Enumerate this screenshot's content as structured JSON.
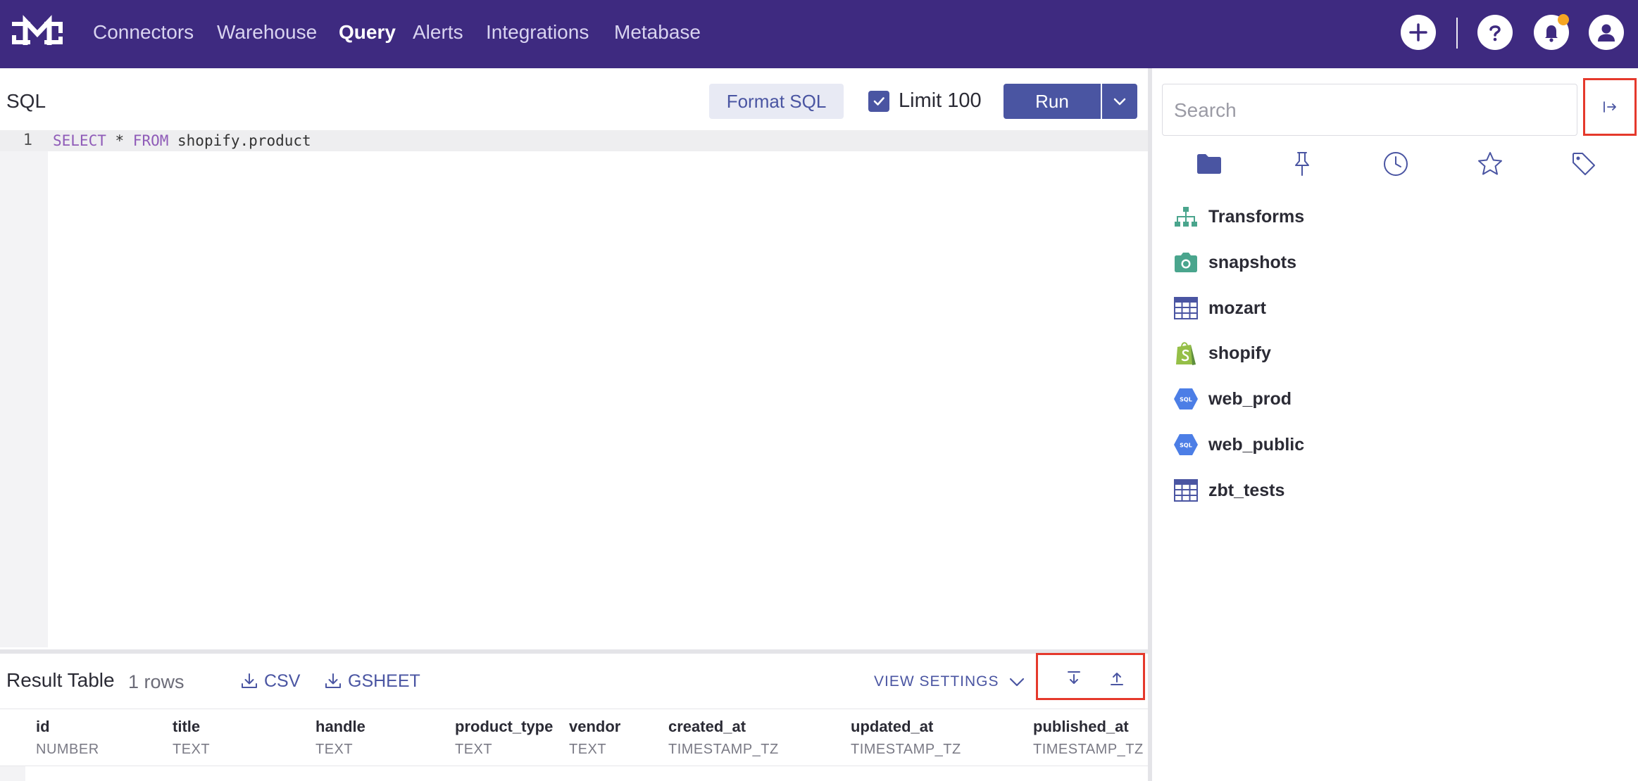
{
  "nav": {
    "items": [
      {
        "label": "Connectors"
      },
      {
        "label": "Warehouse"
      },
      {
        "label": "Query"
      },
      {
        "label": "Alerts"
      },
      {
        "label": "Integrations"
      },
      {
        "label": "Metabase"
      }
    ],
    "active": "Query",
    "logo_letter": "M"
  },
  "editor": {
    "title": "SQL",
    "format_label": "Format SQL",
    "limit_label": "Limit 100",
    "limit_checked": true,
    "run_label": "Run",
    "line_number": "1",
    "code": {
      "kw1": "SELECT",
      "mid": " * ",
      "kw2": "FROM",
      "rest": " shopify.product"
    }
  },
  "results": {
    "title": "Result Table",
    "count": "1 rows",
    "csv_label": "CSV",
    "gsheet_label": "GSHEET",
    "view_settings_label": "VIEW SETTINGS",
    "columns": [
      {
        "name": "id",
        "type": "NUMBER"
      },
      {
        "name": "title",
        "type": "TEXT"
      },
      {
        "name": "handle",
        "type": "TEXT"
      },
      {
        "name": "product_type",
        "type": "TEXT"
      },
      {
        "name": "vendor",
        "type": "TEXT"
      },
      {
        "name": "created_at",
        "type": "TIMESTAMP_TZ"
      },
      {
        "name": "updated_at",
        "type": "TIMESTAMP_TZ"
      },
      {
        "name": "published_at",
        "type": "TIMESTAMP_TZ"
      }
    ]
  },
  "sidebar": {
    "search_placeholder": "Search",
    "tabs": [
      "folder-icon",
      "pin-icon",
      "clock-icon",
      "star-icon",
      "tag-icon"
    ],
    "items": [
      {
        "label": "Transforms",
        "icon": "hierarchy-icon"
      },
      {
        "label": "snapshots",
        "icon": "camera-icon"
      },
      {
        "label": "mozart",
        "icon": "table-icon"
      },
      {
        "label": "shopify",
        "icon": "shopify-icon"
      },
      {
        "label": "web_prod",
        "icon": "sql-hex-icon"
      },
      {
        "label": "web_public",
        "icon": "sql-hex-icon"
      },
      {
        "label": "zbt_tests",
        "icon": "table-icon"
      }
    ]
  },
  "colors": {
    "nav_bg": "#3e2a80",
    "accent": "#4a55a2",
    "highlight_box": "#e5392c",
    "notification": "#f6a623"
  }
}
